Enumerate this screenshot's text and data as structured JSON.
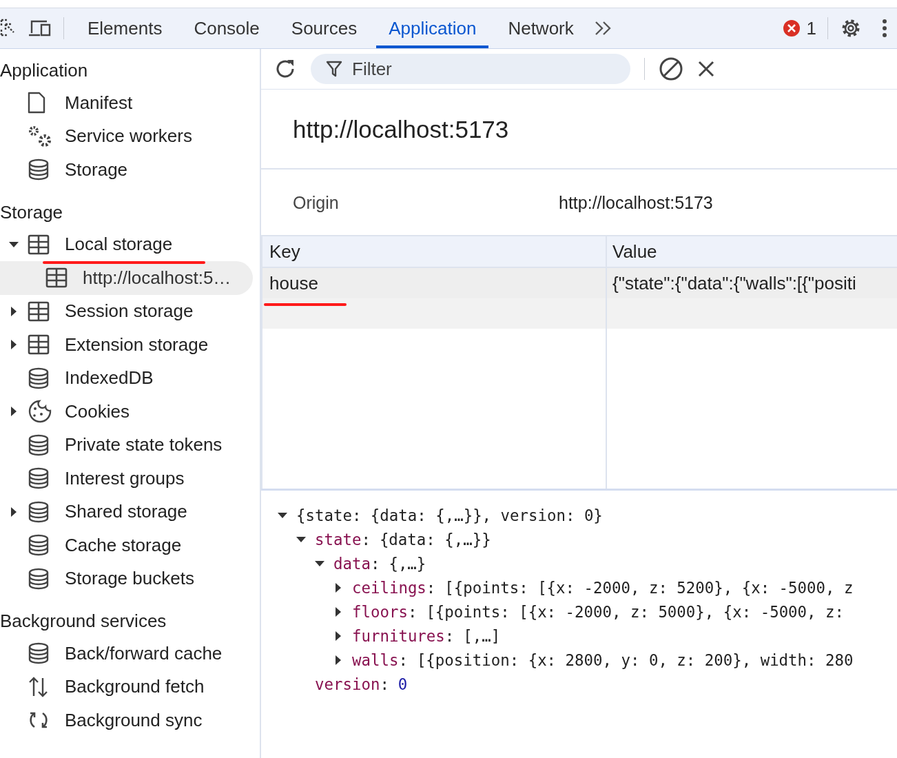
{
  "toolbar": {
    "tabs": [
      {
        "label": "Elements",
        "selected": false
      },
      {
        "label": "Console",
        "selected": false
      },
      {
        "label": "Sources",
        "selected": false
      },
      {
        "label": "Application",
        "selected": true
      },
      {
        "label": "Network",
        "selected": false
      }
    ],
    "error_count": "1"
  },
  "sidebar": {
    "sections": [
      {
        "title": "Application",
        "items": [
          {
            "label": "Manifest",
            "kind": "file"
          },
          {
            "label": "Service workers",
            "kind": "gears"
          },
          {
            "label": "Storage",
            "kind": "database"
          }
        ]
      },
      {
        "title": "Storage",
        "items": [
          {
            "label": "Local storage",
            "kind": "table",
            "expanded": true,
            "underlined": true,
            "children": [
              {
                "label": "http://localhost:5…",
                "kind": "table",
                "selected": true
              }
            ]
          },
          {
            "label": "Session storage",
            "kind": "table",
            "expanded": false
          },
          {
            "label": "Extension storage",
            "kind": "table",
            "expanded": false
          },
          {
            "label": "IndexedDB",
            "kind": "database"
          },
          {
            "label": "Cookies",
            "kind": "cookie",
            "expanded": false
          },
          {
            "label": "Private state tokens",
            "kind": "database"
          },
          {
            "label": "Interest groups",
            "kind": "database"
          },
          {
            "label": "Shared storage",
            "kind": "database",
            "expanded": false
          },
          {
            "label": "Cache storage",
            "kind": "database"
          },
          {
            "label": "Storage buckets",
            "kind": "database"
          }
        ]
      },
      {
        "title": "Background services",
        "items": [
          {
            "label": "Back/forward cache",
            "kind": "database"
          },
          {
            "label": "Background fetch",
            "kind": "updown"
          },
          {
            "label": "Background sync",
            "kind": "sync"
          }
        ]
      }
    ]
  },
  "filter": {
    "placeholder": "Filter"
  },
  "origin_title": "http://localhost:5173",
  "origin": {
    "label": "Origin",
    "value": "http://localhost:5173"
  },
  "table": {
    "columns": [
      "Key",
      "Value"
    ],
    "rows": [
      {
        "key": "house",
        "value": "{\"state\":{\"data\":{\"walls\":[{\"positi",
        "selected": true,
        "underlined": true
      }
    ]
  },
  "preview": [
    {
      "text": "{state: {data: {,…}}, version: 0}",
      "expanded": true,
      "children": [
        {
          "key": "state",
          "separator": ":",
          "value": "{data: {,…}}",
          "expanded": true,
          "children": [
            {
              "key": "data",
              "separator": ":",
              "value": "{,…}",
              "expanded": true,
              "children": [
                {
                  "key": "ceilings",
                  "separator": ":",
                  "value": "[{points: [{x: -2000, z: 5200}, {x: -5000, z",
                  "expanded": false
                },
                {
                  "key": "floors",
                  "separator": ":",
                  "value": "[{points: [{x: -2000, z: 5000}, {x: -5000, z:",
                  "expanded": false
                },
                {
                  "key": "furnitures",
                  "separator": ":",
                  "value": "[,…]",
                  "expanded": false
                },
                {
                  "key": "walls",
                  "separator": ":",
                  "value": "[{position: {x: 2800, y: 0, z: 200}, width: 280",
                  "expanded": false
                }
              ]
            }
          ]
        },
        {
          "key": "version",
          "separator": ":",
          "value": "0",
          "kind": "number"
        }
      ]
    }
  ]
}
